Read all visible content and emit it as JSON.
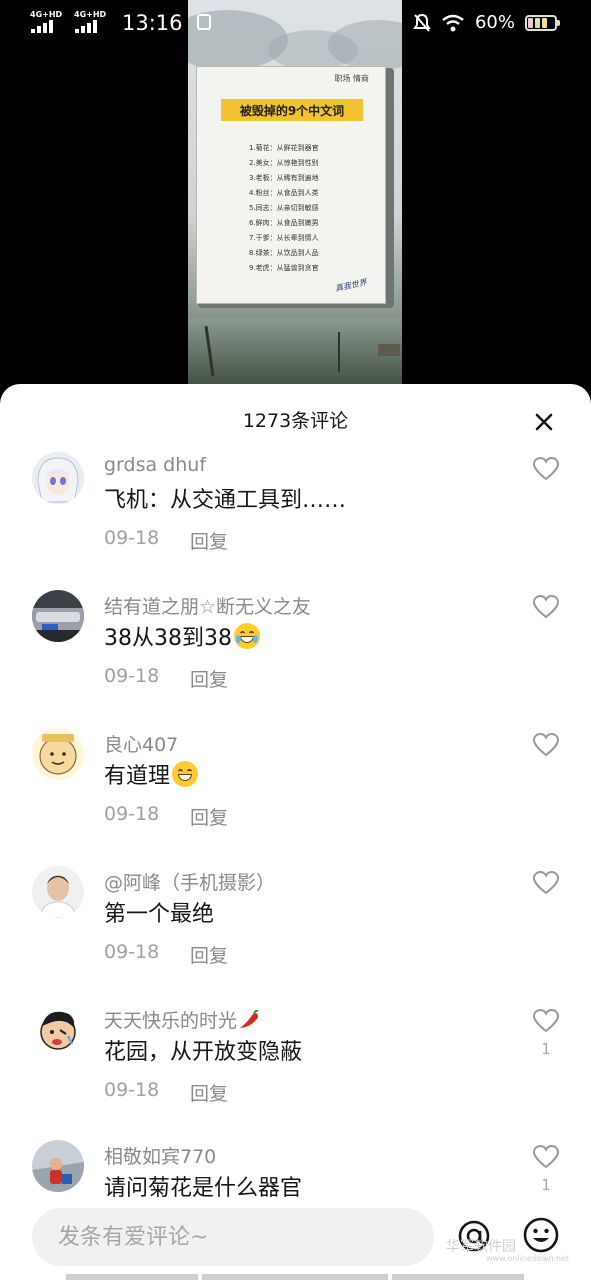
{
  "status_bar": {
    "network_1": "4G+HD",
    "network_2": "4G+HD",
    "time": "13:16",
    "battery_percent": "60%",
    "battery_level": 0.6,
    "icons": [
      "signal-icon",
      "signal-icon",
      "app-notification-icon",
      "mute-icon",
      "wifi-icon",
      "battery-icon"
    ]
  },
  "video": {
    "corner_tag": "职场 情商",
    "heading": "被毁掉的9个中文词",
    "lines": [
      "1.菊花：从鲜花到器官",
      "2.美女：从惊艳到性别",
      "3.老板：从稀有到遍地",
      "4.粉丝：从食品到人类",
      "5.同志：从亲切到敏感",
      "6.鲜肉：从食品到嫩男",
      "7.干爹：从长辈到情人",
      "8.绿茶：从饮品到人品",
      "9.老虎：从猛兽到贪官"
    ],
    "signature": "真我世界"
  },
  "sheet": {
    "title": "1273条评论",
    "close_icon": "close-icon"
  },
  "comments": [
    {
      "user": "grdsa dhuf",
      "text": "飞机：从交通工具到……",
      "date": "09-18",
      "reply": "回复",
      "likes": ""
    },
    {
      "user": "结有道之朋☆断无义之友",
      "text": "38从38到38",
      "emoji": "crying-laughing-emoji",
      "date": "09-18",
      "reply": "回复",
      "likes": ""
    },
    {
      "user": "良心407",
      "text": "有道理",
      "emoji": "grinning-emoji",
      "date": "09-18",
      "reply": "回复",
      "likes": ""
    },
    {
      "user": "@阿峰（手机摄影）",
      "text": "第一个最绝",
      "date": "09-18",
      "reply": "回复",
      "likes": ""
    },
    {
      "user": "天天快乐的时光",
      "user_emoji": "chili-pepper-emoji",
      "text": "花园，从开放变隐蔽",
      "date": "09-18",
      "reply": "回复",
      "likes": "1"
    },
    {
      "user": "相敬如宾770",
      "text": "请问菊花是什么器官",
      "date": "",
      "reply": "",
      "likes": "1"
    }
  ],
  "input": {
    "placeholder": "发条有爱评论~",
    "at_icon": "at-mention-icon",
    "emoji_icon": "emoji-icon"
  },
  "watermark": {
    "text": "华军软件园",
    "url": "www.onlinedown.net"
  },
  "colors": {
    "sheet_bg": "#ffffff",
    "username": "#8a8a8a",
    "comment_text": "#161616",
    "meta": "#a0a0a0",
    "highlight_yellow": "#f2c230"
  }
}
